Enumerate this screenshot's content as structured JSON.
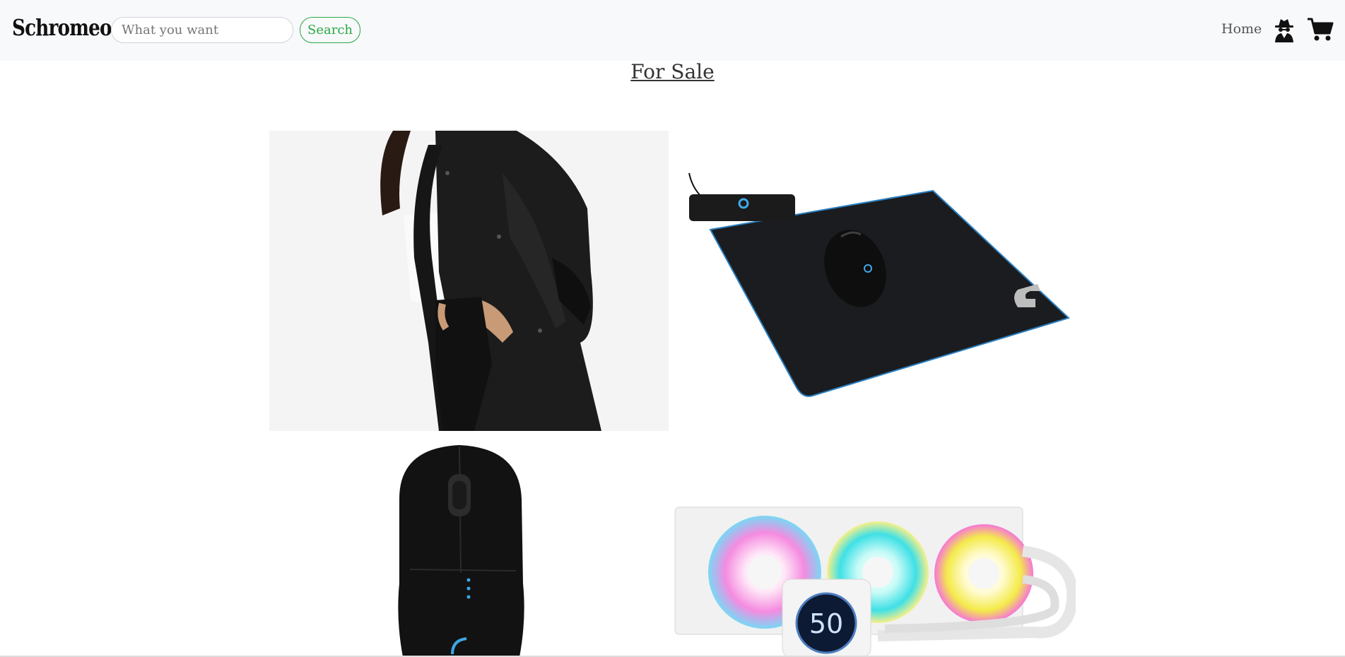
{
  "navbar": {
    "brand": "Schromeo",
    "search_placeholder": "What you want",
    "search_value": "",
    "search_button": "Search",
    "home_link": "Home",
    "icons": [
      "spy-icon",
      "cart-icon"
    ]
  },
  "main": {
    "title": "For Sale",
    "products": [
      {
        "image": "black-denim-jacket"
      },
      {
        "image": "wireless-charging-mousepad-with-mouse"
      },
      {
        "image": "black-gaming-mouse"
      },
      {
        "image": "white-rgb-liquid-cooler",
        "display_value": "50"
      }
    ]
  },
  "colors": {
    "navbar_bg": "#f8f9fa",
    "search_accent": "#28a745",
    "text": "#333333"
  }
}
